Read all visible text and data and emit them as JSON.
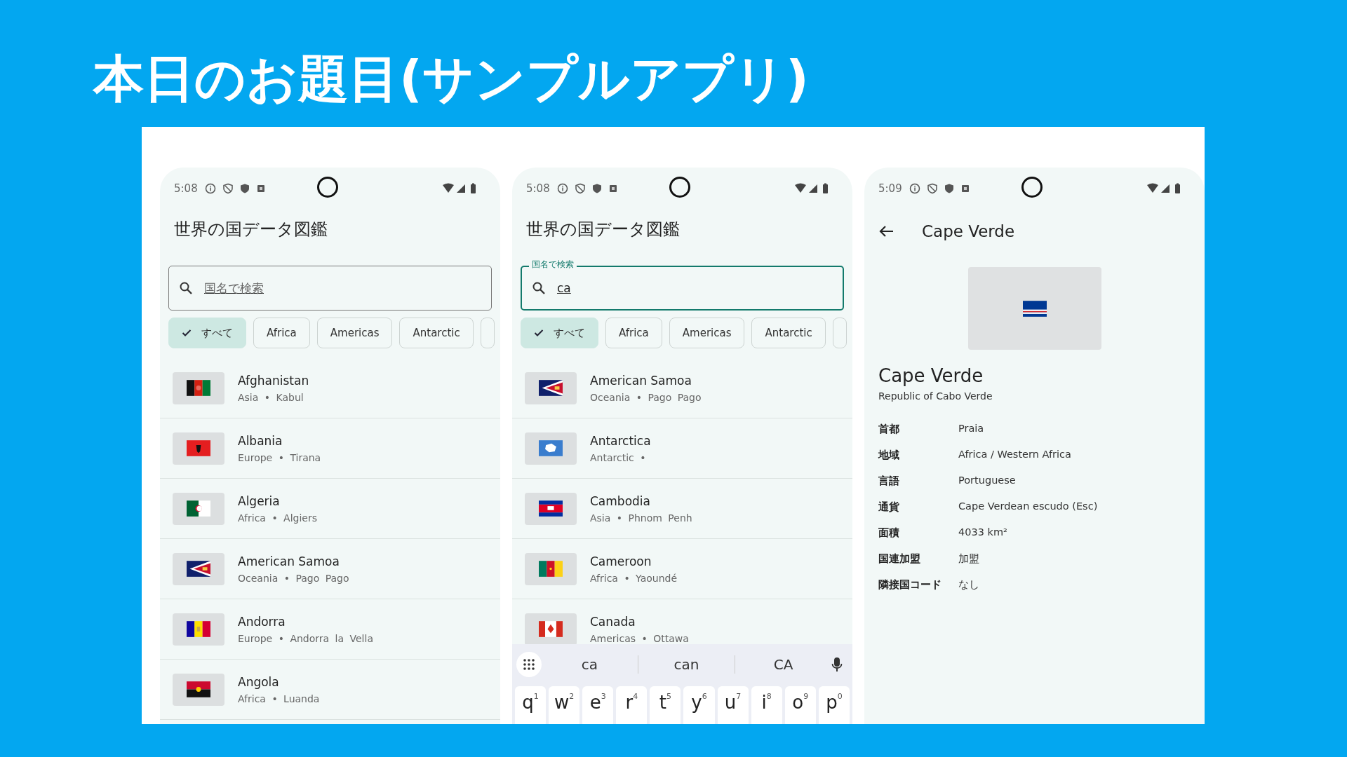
{
  "slide_title": "本日のお題目(サンプルアプリ)",
  "phones": [
    {
      "kind": "list",
      "status_time": "5:08",
      "app_title": "世界の国データ図鑑",
      "search": {
        "placeholder": "国名で検索",
        "focused": false
      },
      "chips": [
        {
          "label": "すべて",
          "selected": true
        },
        {
          "label": "Africa",
          "selected": false
        },
        {
          "label": "Americas",
          "selected": false
        },
        {
          "label": "Antarctic",
          "selected": false
        }
      ],
      "rows": [
        {
          "name": "Afghanistan",
          "subtitle": "Asia • Kabul"
        },
        {
          "name": "Albania",
          "subtitle": "Europe • Tirana"
        },
        {
          "name": "Algeria",
          "subtitle": "Africa • Algiers"
        },
        {
          "name": "American Samoa",
          "subtitle": "Oceania • Pago Pago"
        },
        {
          "name": "Andorra",
          "subtitle": "Europe • Andorra la Vella"
        },
        {
          "name": "Angola",
          "subtitle": "Africa • Luanda"
        }
      ]
    },
    {
      "kind": "list",
      "status_time": "5:08",
      "app_title": "世界の国データ図鑑",
      "search": {
        "label": "国名で検索",
        "value": "ca",
        "focused": true
      },
      "chips": [
        {
          "label": "すべて",
          "selected": true
        },
        {
          "label": "Africa",
          "selected": false
        },
        {
          "label": "Americas",
          "selected": false
        },
        {
          "label": "Antarctic",
          "selected": false
        }
      ],
      "rows": [
        {
          "name": "American Samoa",
          "subtitle": "Oceania • Pago Pago"
        },
        {
          "name": "Antarctica",
          "subtitle": "Antarctic •"
        },
        {
          "name": "Cambodia",
          "subtitle": "Asia • Phnom Penh"
        },
        {
          "name": "Cameroon",
          "subtitle": "Africa • Yaoundé"
        },
        {
          "name": "Canada",
          "subtitle": "Americas • Ottawa"
        }
      ],
      "keyboard": {
        "suggestions": [
          "ca",
          "can",
          "CA"
        ],
        "keys": [
          {
            "letter": "q",
            "hint": "1"
          },
          {
            "letter": "w",
            "hint": "2"
          },
          {
            "letter": "e",
            "hint": "3"
          },
          {
            "letter": "r",
            "hint": "4"
          },
          {
            "letter": "t",
            "hint": "5"
          },
          {
            "letter": "y",
            "hint": "6"
          },
          {
            "letter": "u",
            "hint": "7"
          },
          {
            "letter": "i",
            "hint": "8"
          },
          {
            "letter": "o",
            "hint": "9"
          },
          {
            "letter": "p",
            "hint": "0"
          }
        ]
      }
    },
    {
      "kind": "detail",
      "status_time": "5:09",
      "toolbar_title": "Cape Verde",
      "name": "Cape Verde",
      "official_name": "Republic of Cabo Verde",
      "details": [
        {
          "label": "首都",
          "value": "Praia"
        },
        {
          "label": "地域",
          "value": "Africa / Western Africa"
        },
        {
          "label": "言語",
          "value": "Portuguese"
        },
        {
          "label": "通貨",
          "value": "Cape Verdean escudo (Esc)"
        },
        {
          "label": "面積",
          "value": "4033 km²"
        },
        {
          "label": "国連加盟",
          "value": "加盟"
        },
        {
          "label": "隣接国コード",
          "value": "なし"
        }
      ]
    }
  ]
}
